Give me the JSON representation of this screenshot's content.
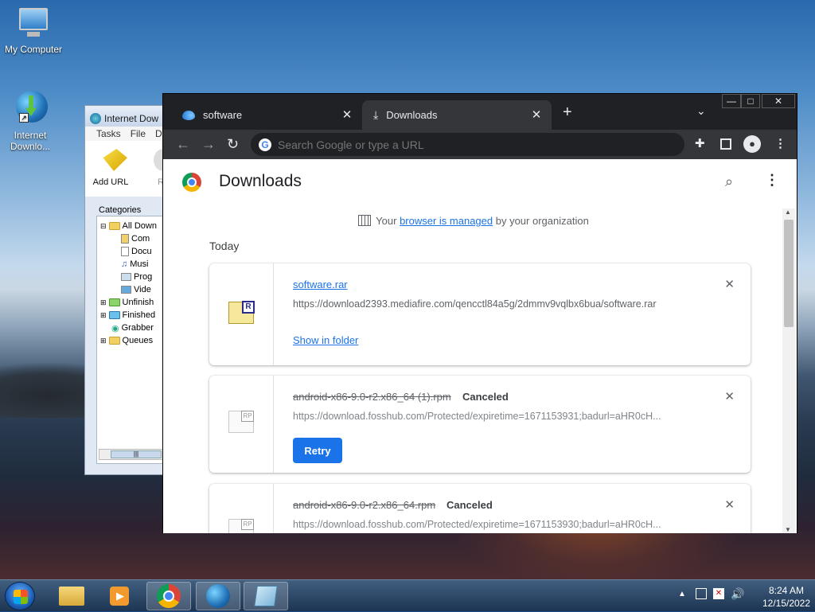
{
  "desktop": {
    "icons": [
      {
        "label": "My Computer"
      },
      {
        "label": "Internet Downlo..."
      }
    ]
  },
  "idm": {
    "title": "Internet Dow",
    "menu": [
      "Tasks",
      "File",
      "D"
    ],
    "toolbar": {
      "add_url": "Add URL",
      "re": "Re"
    },
    "categories_header": "Categories",
    "tree": [
      "All Down",
      "Com",
      "Docu",
      "Musi",
      "Prog",
      "Vide",
      "Unfinish",
      "Finished",
      "Grabber",
      "Queues"
    ]
  },
  "chrome": {
    "tabs": [
      {
        "label": "software"
      },
      {
        "label": "Downloads"
      }
    ],
    "omnibox_placeholder": "Search Google or type a URL",
    "page_title": "Downloads",
    "managed": {
      "pre": "Your ",
      "link": "browser is managed",
      "post": " by your organization"
    },
    "section": "Today",
    "downloads": [
      {
        "name": "software.rar",
        "url": "https://download2393.mediafire.com/qencctl84a5g/2dmmv9vqlbx6bua/software.rar",
        "action": "Show in folder",
        "status": ""
      },
      {
        "name": "android-x86-9.0-r2.x86_64 (1).rpm",
        "status": "Canceled",
        "url": "https://download.fosshub.com/Protected/expiretime=1671153931;badurl=aHR0cH...",
        "action": "Retry"
      },
      {
        "name": "android-x86-9.0-r2.x86_64.rpm",
        "status": "Canceled",
        "url": "https://download.fosshub.com/Protected/expiretime=1671153930;badurl=aHR0cH...",
        "action": ""
      }
    ],
    "file_icon_labels": [
      "R",
      "RP",
      "RP"
    ]
  },
  "taskbar": {
    "clock_time": "8:24 AM",
    "clock_date": "12/15/2022"
  },
  "colors": {
    "accent": "#1a73e8",
    "chrome_dark": "#202124",
    "toolbar": "#35363a"
  }
}
